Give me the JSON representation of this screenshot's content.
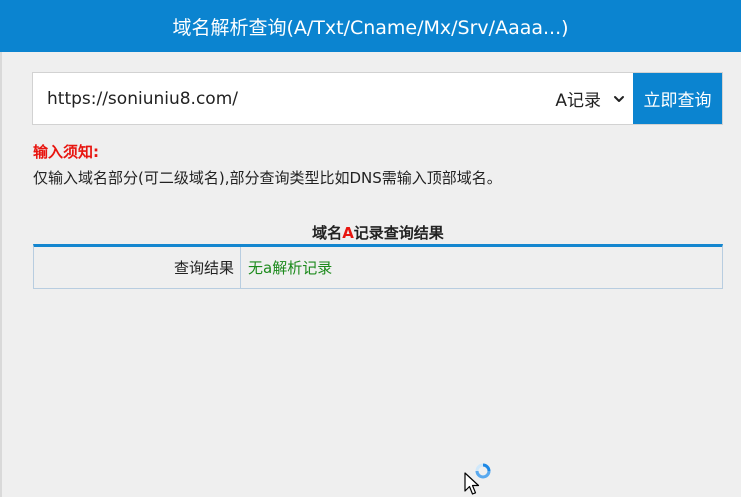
{
  "header": {
    "title": "域名解析查询(A/Txt/Cname/Mx/Srv/Aaaa...)"
  },
  "query": {
    "url_value": "https://soniuniu8.com/",
    "record_type": "A记录",
    "submit_label": "立即查询"
  },
  "notice": {
    "title": "输入须知:",
    "text": "仅输入域名部分(可二级域名),部分查询类型比如DNS需输入顶部域名。"
  },
  "result": {
    "heading_prefix": "域名",
    "heading_type": "A",
    "heading_suffix": "记录查询结果",
    "label": "查询结果",
    "value": "无a解析记录"
  },
  "colors": {
    "accent": "#0b84d0",
    "warning": "#e8150f",
    "success_text": "#1c8a1c"
  },
  "icons": [
    "chevron-down-icon",
    "busy-cursor-icon"
  ]
}
